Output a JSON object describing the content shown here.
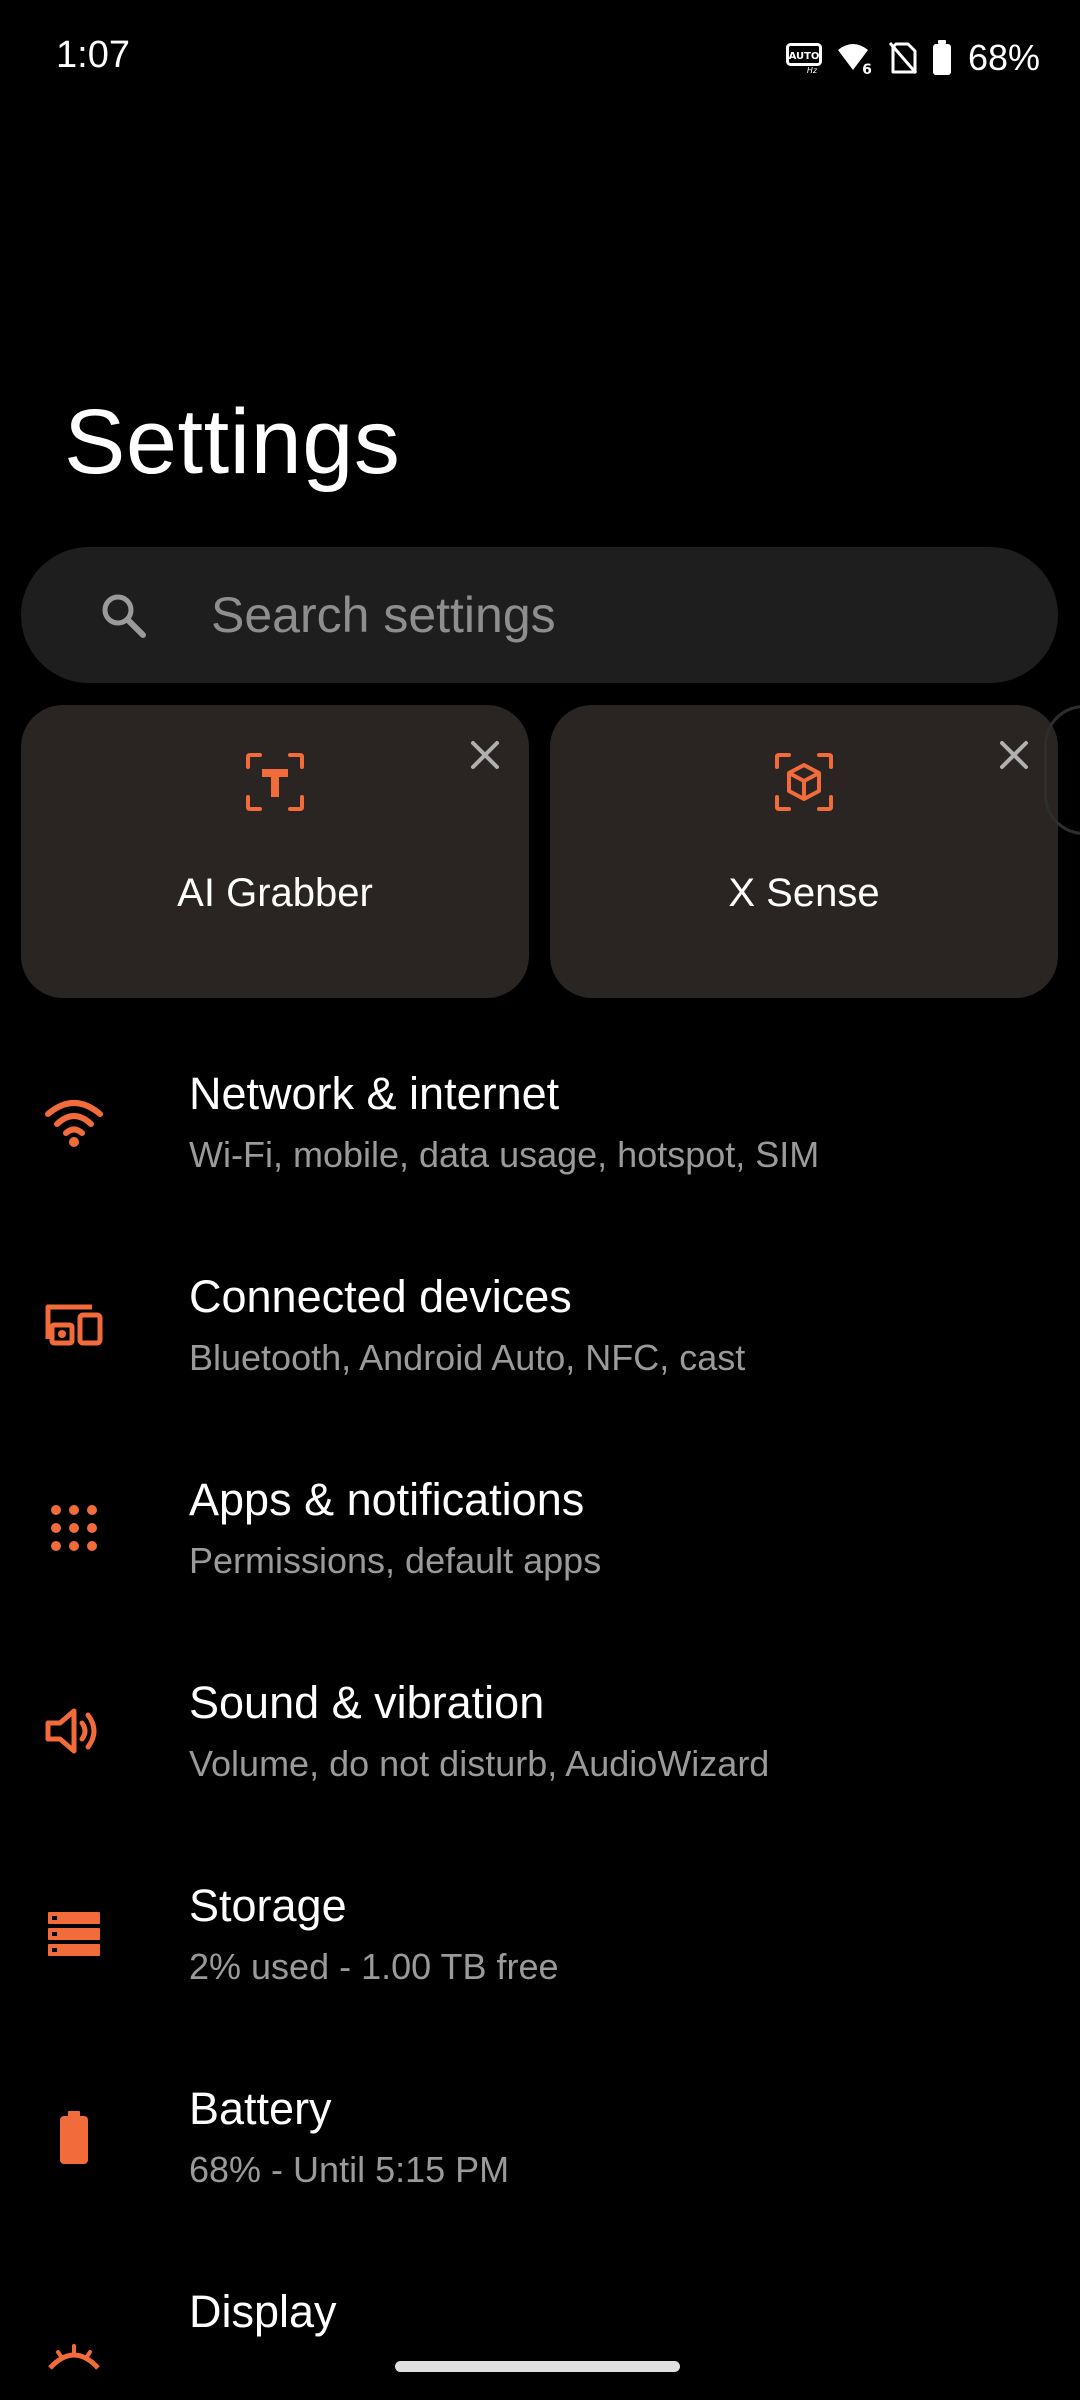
{
  "status_bar": {
    "time": "1:07",
    "battery_percent": "68%",
    "icons": [
      "refresh-rate-auto-icon",
      "wifi-6-icon",
      "no-sim-icon",
      "battery-icon"
    ]
  },
  "page": {
    "title": "Settings"
  },
  "search": {
    "placeholder": "Search settings",
    "value": ""
  },
  "suggestions": [
    {
      "label": "AI Grabber",
      "icon": "text-scan-icon"
    },
    {
      "label": "X Sense",
      "icon": "cube-scan-icon"
    }
  ],
  "settings": [
    {
      "title": "Network & internet",
      "subtitle": "Wi-Fi, mobile, data usage, hotspot, SIM",
      "icon": "wifi-icon"
    },
    {
      "title": "Connected devices",
      "subtitle": "Bluetooth, Android Auto, NFC, cast",
      "icon": "devices-icon"
    },
    {
      "title": "Apps & notifications",
      "subtitle": "Permissions, default apps",
      "icon": "apps-grid-icon"
    },
    {
      "title": "Sound & vibration",
      "subtitle": "Volume, do not disturb, AudioWizard",
      "icon": "speaker-icon"
    },
    {
      "title": "Storage",
      "subtitle": "2% used - 1.00 TB free",
      "icon": "storage-icon"
    },
    {
      "title": "Battery",
      "subtitle": "68% - Until 5:15 PM",
      "icon": "battery-icon"
    },
    {
      "title": "Display",
      "subtitle": "",
      "icon": "display-icon"
    }
  ],
  "colors": {
    "accent": "#f26b3a",
    "background": "#000000",
    "card": "#2a2422",
    "search_bg": "#1e1e1e",
    "secondary_text": "#9a9a9a"
  }
}
